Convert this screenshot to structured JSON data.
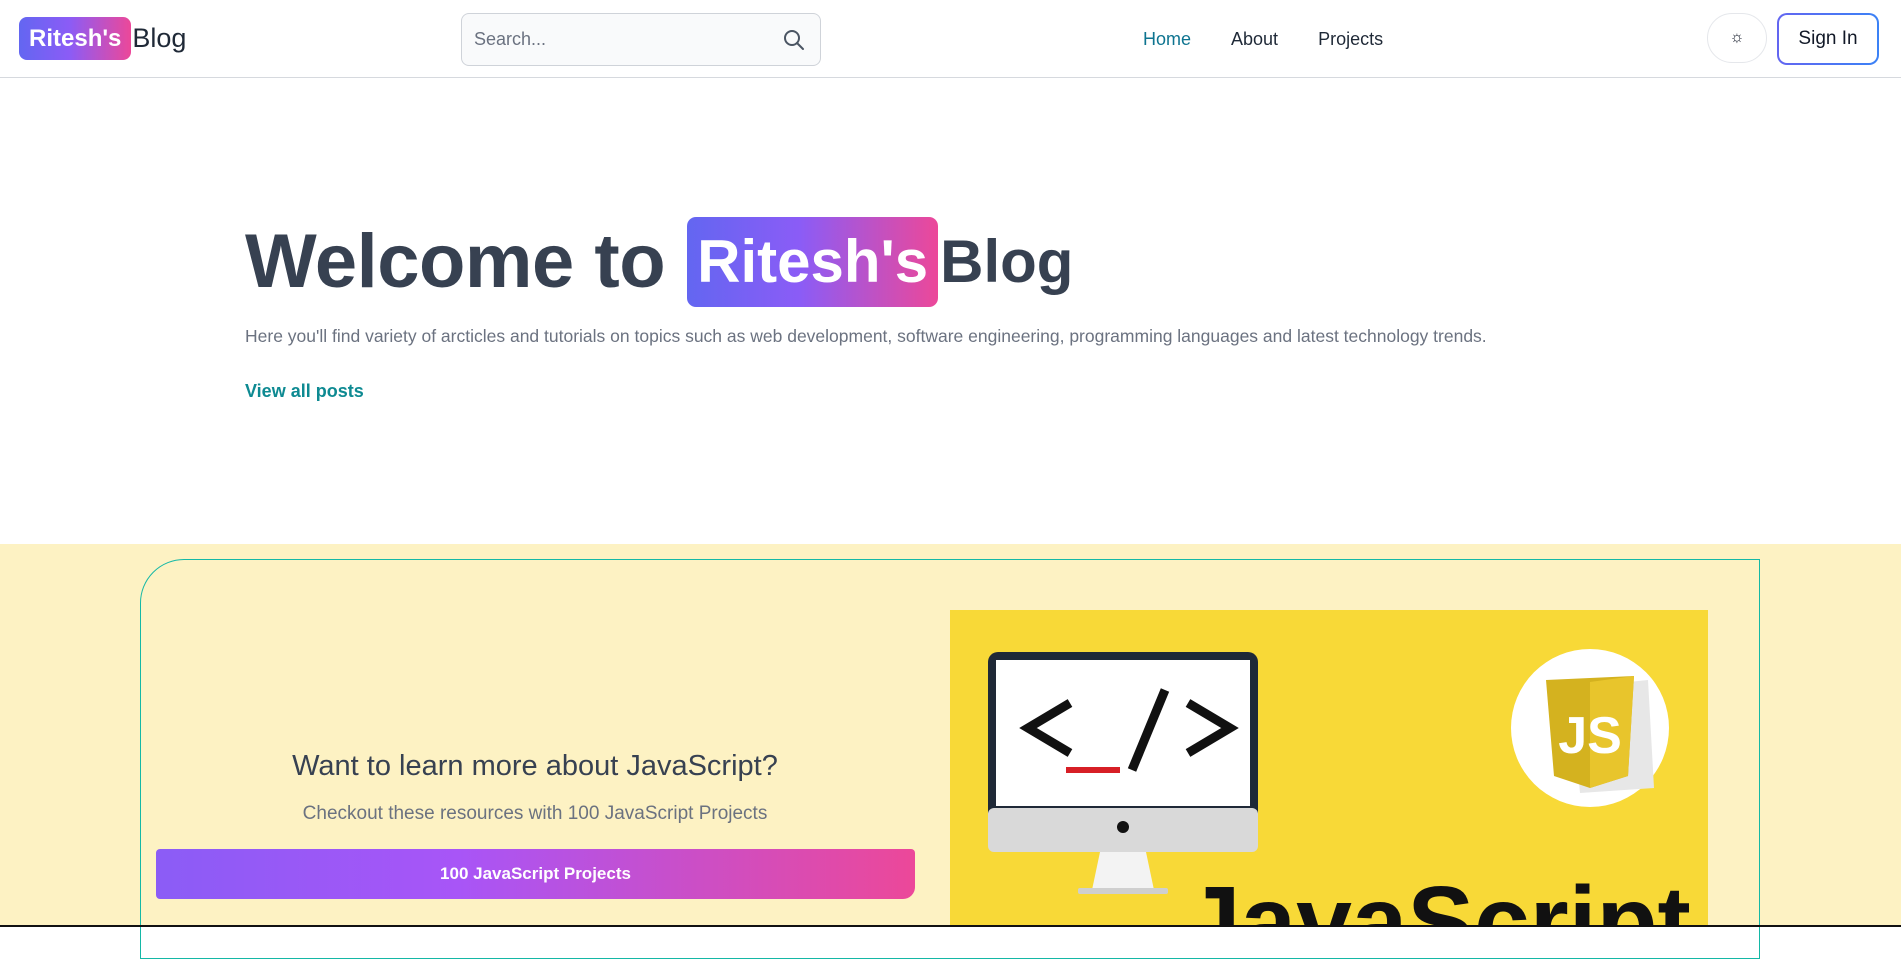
{
  "header": {
    "logo_badge": "Ritesh's",
    "logo_text": "Blog",
    "search_placeholder": "Search...",
    "nav": [
      {
        "label": "Home",
        "active": true
      },
      {
        "label": "About",
        "active": false
      },
      {
        "label": "Projects",
        "active": false
      }
    ],
    "theme_icon": "☼",
    "signin_label": "Sign In"
  },
  "hero": {
    "welcome": "Welcome to",
    "badge": "Ritesh's",
    "blog": "Blog",
    "subtitle": "Here you'll find variety of arcticles and tutorials on topics such as web development, software engineering, programming languages and latest technology trends.",
    "link": "View all posts"
  },
  "promo": {
    "heading": "Want to learn more about JavaScript?",
    "subtitle": "Checkout these resources with 100 JavaScript Projects",
    "button": "100 JavaScript Projects",
    "image": {
      "code_symbol": "<_/>",
      "logo_text": "JS",
      "caption": "JavaScript"
    }
  },
  "colors": {
    "accent_teal": "#0e7490",
    "gradient_start": "#6366f1",
    "gradient_end": "#ec4899",
    "promo_bg": "#fdf2c3",
    "js_yellow": "#f8d937"
  },
  "icons": [
    "search-icon",
    "sun-icon",
    "monitor-icon",
    "js-logo-icon"
  ]
}
